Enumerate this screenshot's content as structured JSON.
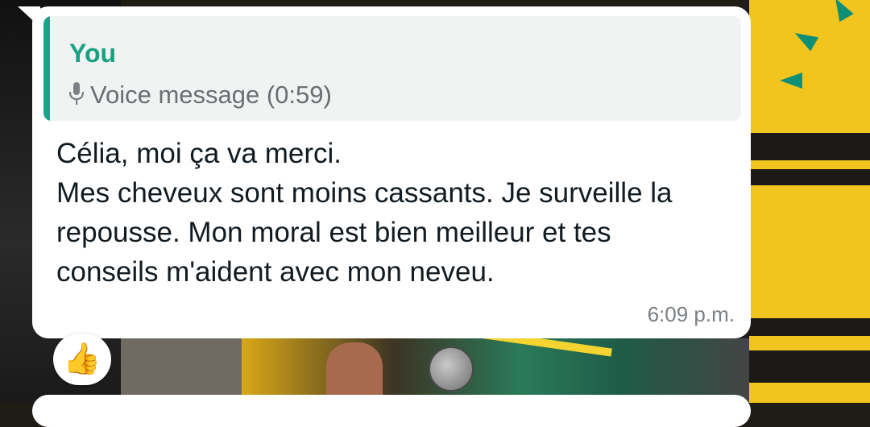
{
  "message": {
    "quoted": {
      "author": "You",
      "icon": "mic-icon",
      "text": "Voice message (0:59)"
    },
    "body": "Célia, moi ça va merci.\nMes cheveux sont moins cassants. Je surveille la repousse. Mon moral est bien meilleur et tes conseils m'aident avec mon neveu.",
    "time": "6:09 p.m."
  },
  "reaction": {
    "emoji": "👍",
    "icon": "thumbs-up-icon"
  },
  "colors": {
    "accent": "#1aa58a",
    "author": "#18a181",
    "bubble": "#ffffff",
    "quote_bg": "#f1f2f2",
    "text": "#111b21",
    "muted": "#7a7f83"
  }
}
